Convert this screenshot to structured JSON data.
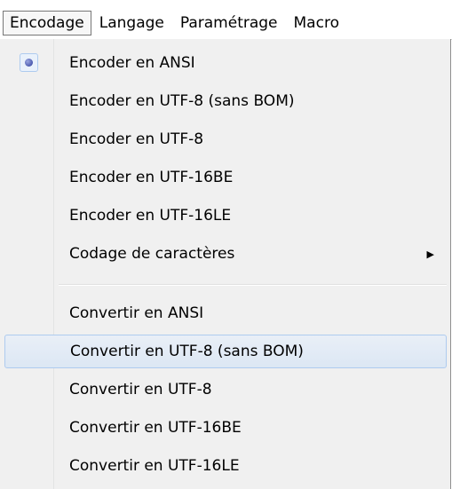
{
  "menubar": {
    "items": [
      {
        "label": "Encodage",
        "active": true
      },
      {
        "label": "Langage"
      },
      {
        "label": "Paramétrage"
      },
      {
        "label": "Macro"
      }
    ]
  },
  "menu": {
    "encode_items": [
      {
        "label": "Encoder en ANSI",
        "checked": true
      },
      {
        "label": "Encoder en UTF-8 (sans BOM)"
      },
      {
        "label": "Encoder en UTF-8"
      },
      {
        "label": "Encoder en UTF-16BE"
      },
      {
        "label": "Encoder en UTF-16LE"
      },
      {
        "label": "Codage de caractères",
        "submenu": true
      }
    ],
    "convert_items": [
      {
        "label": "Convertir en ANSI"
      },
      {
        "label": "Convertir en UTF-8 (sans BOM)",
        "hover": true
      },
      {
        "label": "Convertir en UTF-8"
      },
      {
        "label": "Convertir en UTF-16BE"
      },
      {
        "label": "Convertir en UTF-16LE"
      }
    ],
    "submenu_arrow": "▶",
    "radio_icon": "radio-bullet-icon"
  }
}
